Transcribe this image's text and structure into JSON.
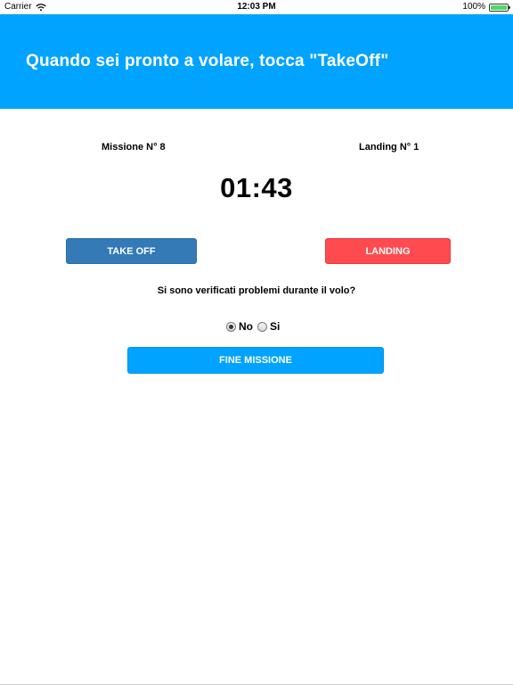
{
  "status_bar": {
    "carrier": "Carrier",
    "time": "12:03 PM",
    "battery_percent": "100%",
    "wifi_icon": "wifi-icon",
    "battery_icon": "battery-icon",
    "battery_level": 1.0,
    "battery_color": "#4cd964"
  },
  "header": {
    "title": "Quando sei pronto a volare, tocca \"TakeOff\"",
    "background": "#00a3ff"
  },
  "mission": {
    "mission_label": "Missione N° 8",
    "landing_label": "Landing N° 1",
    "timer": "01:43"
  },
  "actions": {
    "takeoff_label": "TAKE OFF",
    "takeoff_color": "#337ab7",
    "landing_label": "LANDING",
    "landing_color": "#ff4a4f"
  },
  "problems": {
    "question": "Si sono verificati problemi durante il volo?",
    "options": [
      {
        "label": "No",
        "selected": true
      },
      {
        "label": "Si",
        "selected": false
      }
    ]
  },
  "finish": {
    "label": "FINE MISSIONE",
    "color": "#00a3ff"
  }
}
